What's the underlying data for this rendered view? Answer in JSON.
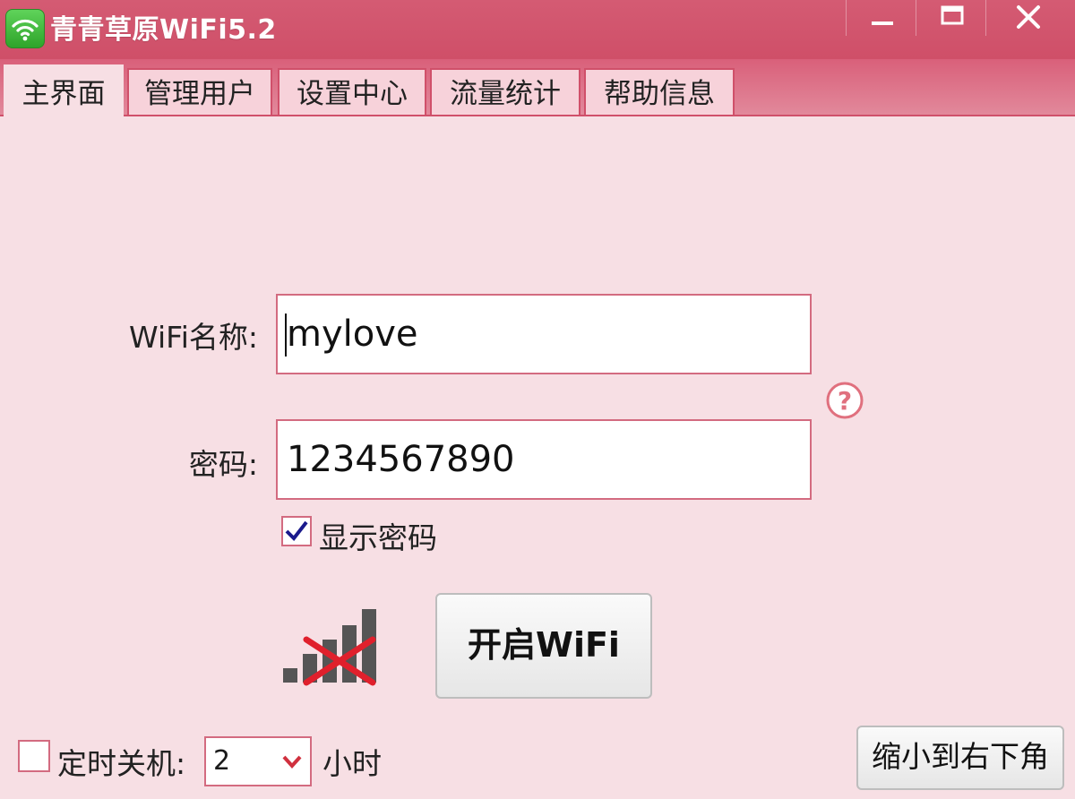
{
  "window": {
    "title": "青青草原WiFi5.2",
    "controls": {
      "minimize_icon": "minimize-icon",
      "maximize_icon": "maximize-icon",
      "close_icon": "close-icon"
    }
  },
  "tabs": [
    {
      "label": "主界面",
      "active": true
    },
    {
      "label": "管理用户",
      "active": false
    },
    {
      "label": "设置中心",
      "active": false
    },
    {
      "label": "流量统计",
      "active": false
    },
    {
      "label": "帮助信息",
      "active": false
    }
  ],
  "form": {
    "wifi_name_label": "WiFi名称:",
    "wifi_name_value": "mylove",
    "password_label": "密码:",
    "password_value": "1234567890",
    "help_icon": "question-icon",
    "show_password": {
      "label": "显示密码",
      "checked": true
    }
  },
  "status": {
    "signal_icon": "signal-disconnected-icon"
  },
  "buttons": {
    "start_wifi": "开启WiFi",
    "minimize_to_corner": "缩小到右下角"
  },
  "shutdown": {
    "checked": false,
    "label": "定时关机:",
    "hours_value": "2",
    "unit": "小时"
  },
  "colors": {
    "accent": "#d0506a",
    "titlebar": "#d45b73",
    "background": "#f7dfe4",
    "cross": "#e0202c",
    "checkmark": "#1a1a8c"
  }
}
